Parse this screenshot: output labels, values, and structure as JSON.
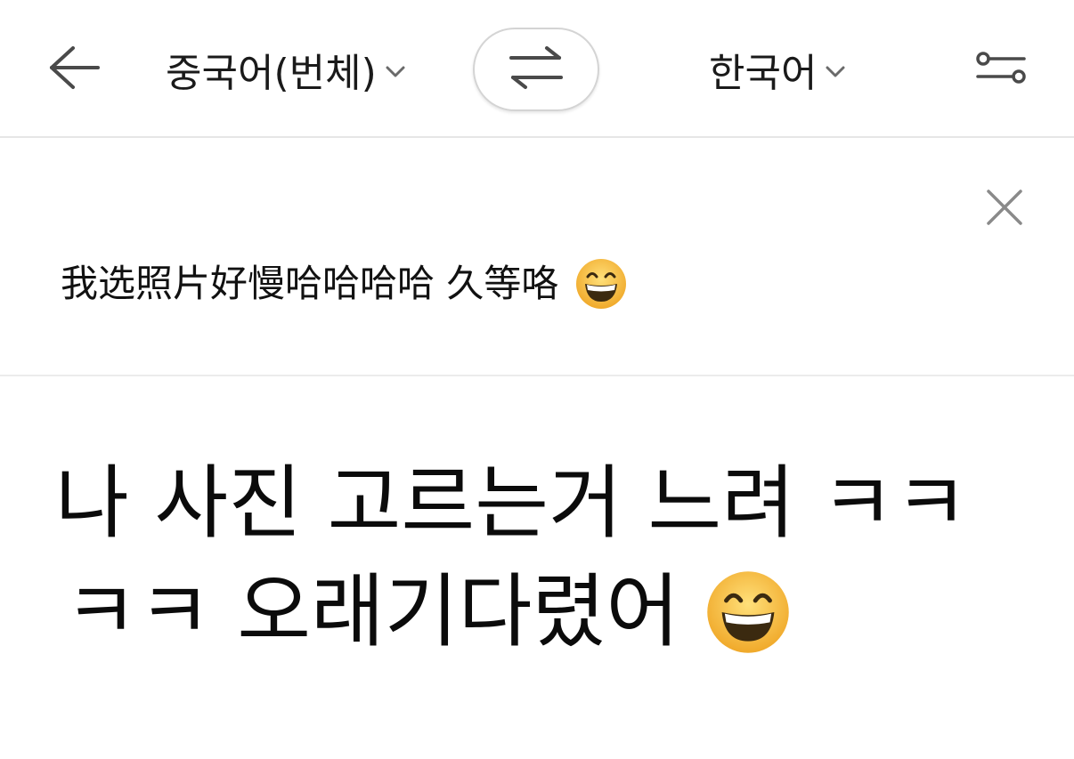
{
  "header": {
    "back_icon": "arrow-left-icon",
    "source_language": "중국어(번체)",
    "swap_icon": "swap-arrows-icon",
    "target_language": "한국어",
    "dropdown_icon": "chevron-down-icon",
    "settings_icon": "sliders-icon"
  },
  "source": {
    "text": "我选照片好慢哈哈哈哈 久等咯",
    "emoji": "grinning-face-with-smiling-eyes",
    "clear_icon": "close-icon"
  },
  "result": {
    "line1": "나 사진 고르는거 느려 ㅋㅋ",
    "line2": "ㅋㅋ 오래기다렸어",
    "emoji": "grinning-face-with-smiling-eyes"
  },
  "colors": {
    "icon": "#4a4a4a",
    "divider": "#e6e6e6",
    "emoji_face": "#f7c43c"
  }
}
